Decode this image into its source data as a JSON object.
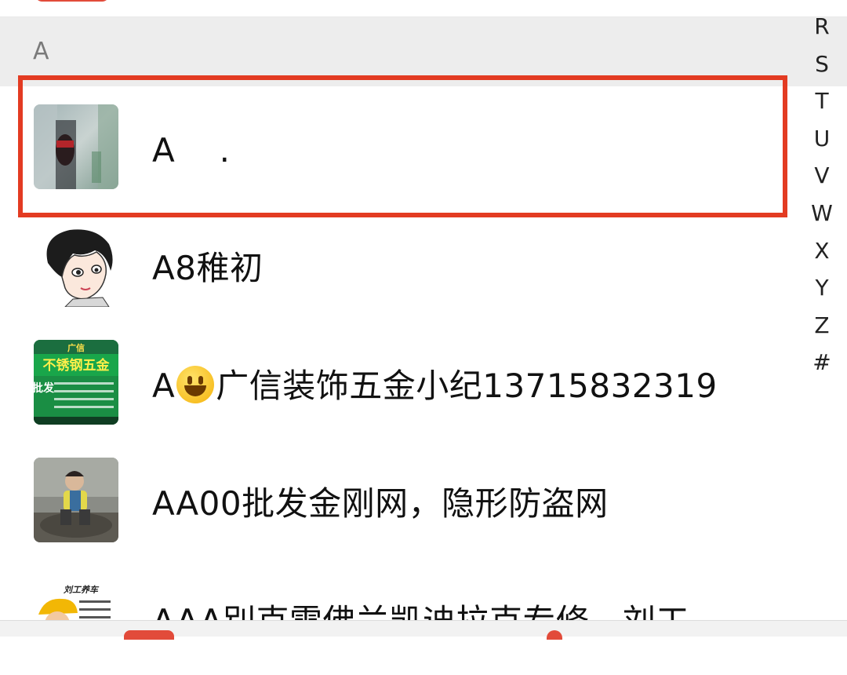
{
  "section": {
    "letter": "A"
  },
  "contacts": [
    {
      "name": "A　 ."
    },
    {
      "name": "A8稚初"
    },
    {
      "name_prefix": "A",
      "emoji": "grinning-face-emoji",
      "name_suffix": "广信装饰五金小纪13715832319"
    },
    {
      "name": "AA00批发金刚网，隐形防盗网"
    },
    {
      "name": "AAA別克雪佛兰凯迪拉克专修，刘工"
    }
  ],
  "avatar_texts": {
    "contact3": {
      "title": "广信",
      "line1": "不锈钢五金",
      "line2": "批发"
    },
    "contact5": {
      "title": "刘工养车"
    }
  },
  "alphabet_index": [
    "R",
    "S",
    "T",
    "U",
    "V",
    "W",
    "X",
    "Y",
    "Z",
    "#"
  ],
  "colors": {
    "highlight": "#e33b22",
    "section_bg": "#ededed",
    "accent": "#e24b3a"
  }
}
